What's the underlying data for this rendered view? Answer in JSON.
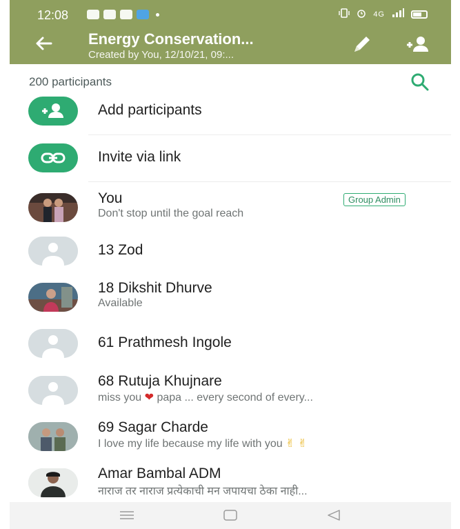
{
  "status_bar": {
    "time": "12:08",
    "network_text": "4G",
    "colors": {
      "bar": "#8f9f5e"
    }
  },
  "header": {
    "title": "Energy Conservation...",
    "subtitle": "Created by You, 12/10/21, 09:...",
    "back_icon": "arrow-left-icon",
    "edit_icon": "pencil-icon",
    "add_icon": "person-add-icon"
  },
  "participants": {
    "count_label": "200 participants",
    "search_icon": "search-icon"
  },
  "actions": [
    {
      "label": "Add participants",
      "icon": "person-add-icon"
    },
    {
      "label": "Invite via link",
      "icon": "link-icon"
    }
  ],
  "members": [
    {
      "name": "You",
      "status": "Don't stop until the goal reach",
      "badge": "Group Admin",
      "avatar": "photo-couple"
    },
    {
      "name": "13 Zod",
      "status": "",
      "avatar": "default"
    },
    {
      "name": "18 Dikshit Dhurve",
      "status": "Available",
      "avatar": "photo-person"
    },
    {
      "name": "61 Prathmesh Ingole",
      "status": "",
      "avatar": "default"
    },
    {
      "name": "68 Rutuja Khujnare",
      "status_before": "miss you",
      "status_after": "papa ... every second of every...",
      "avatar": "default"
    },
    {
      "name": "69 Sagar Charde",
      "status": "I love my life because my life with you",
      "avatar": "photo-group"
    },
    {
      "name": "Amar Bambal ADM",
      "status": "नाराज तर नाराज  प्रत्येकाची मन जपायचा ठेका  नाही...",
      "avatar": "photo-man"
    }
  ],
  "nav": {
    "menu_icon": "menu-icon",
    "home_icon": "home-square-icon",
    "back_icon": "back-triangle-icon"
  },
  "colors": {
    "accent": "#2eab72",
    "header": "#8f9f5e",
    "text_secondary": "#6f7474"
  }
}
